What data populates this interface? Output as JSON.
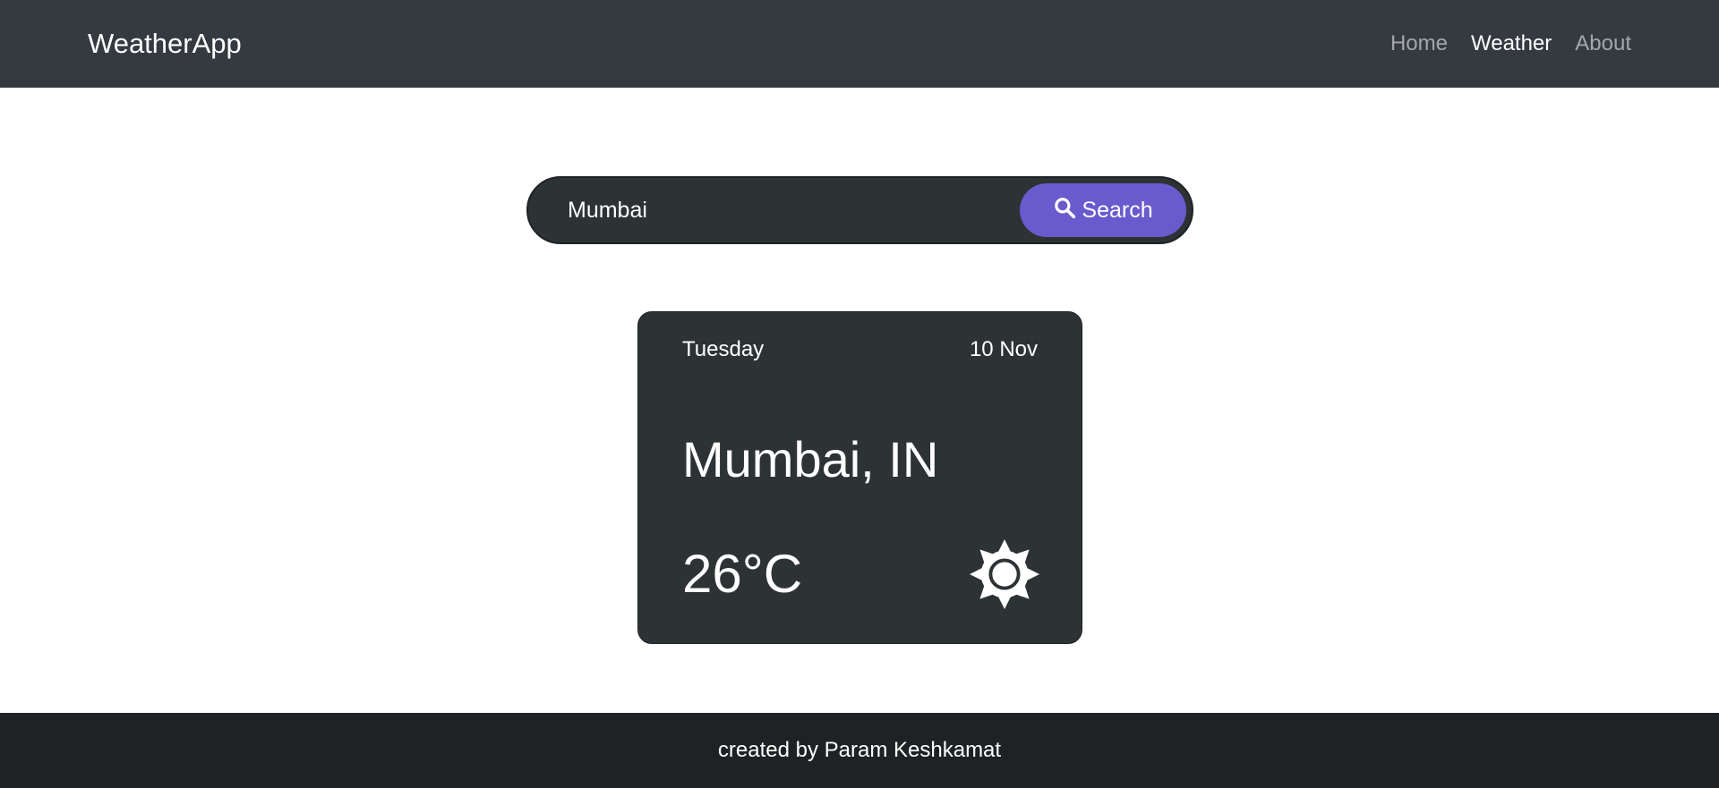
{
  "navbar": {
    "brand": "WeatherApp",
    "links": [
      {
        "label": "Home",
        "active": false
      },
      {
        "label": "Weather",
        "active": true
      },
      {
        "label": "About",
        "active": false
      }
    ]
  },
  "search": {
    "value": "Mumbai",
    "button_label": "Search",
    "button_icon": "search-icon",
    "button_color": "#6a5acd"
  },
  "card": {
    "day": "Tuesday",
    "date": "10 Nov",
    "city": "Mumbai, IN",
    "temperature": "26°C",
    "condition_icon": "sun-icon"
  },
  "footer": {
    "text": "created by Param Keshkamat"
  }
}
